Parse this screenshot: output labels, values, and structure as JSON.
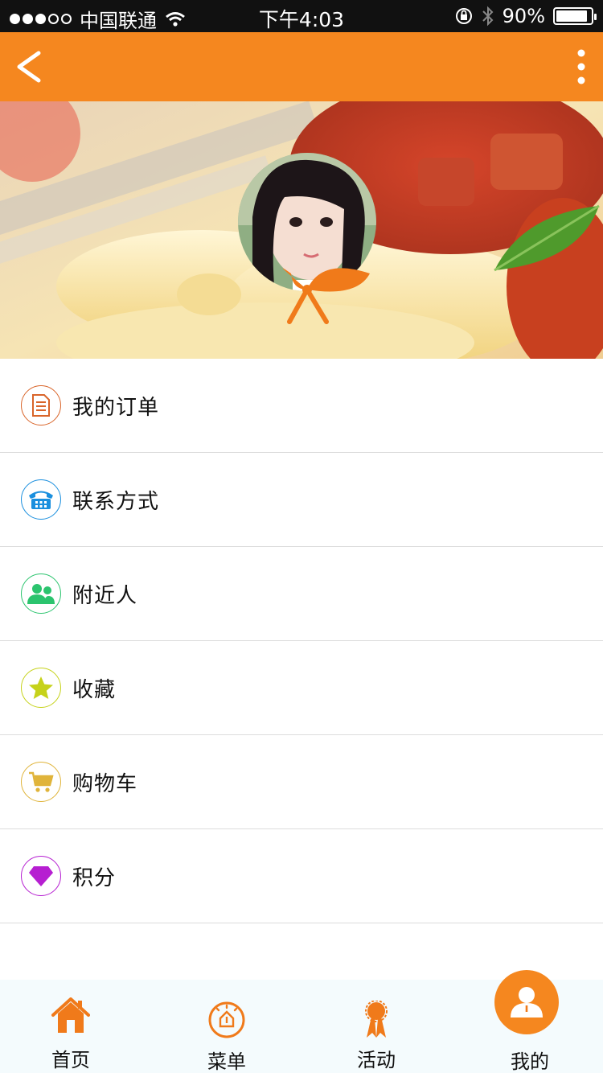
{
  "status_bar": {
    "carrier": "中国联通",
    "time": "下午4:03",
    "battery": "90%",
    "battery_level": 0.9,
    "signal_bars": 3
  },
  "nav": {
    "back_icon": "chevron-left-icon",
    "more_icon": "vertical-ellipsis-icon",
    "bg_color": "#f5871f"
  },
  "menu": {
    "items": [
      {
        "label": "我的订单",
        "icon": "document-icon",
        "color": "#d9652a"
      },
      {
        "label": "联系方式",
        "icon": "telephone-icon",
        "color": "#1a8fde"
      },
      {
        "label": "附近人",
        "icon": "people-icon",
        "color": "#2bc46e"
      },
      {
        "label": "收藏",
        "icon": "star-icon",
        "color": "#c6d21a"
      },
      {
        "label": "购物车",
        "icon": "cart-icon",
        "color": "#e0b43a"
      },
      {
        "label": "积分",
        "icon": "diamond-icon",
        "color": "#b61fd1"
      }
    ]
  },
  "tabs": [
    {
      "label": "首页",
      "icon": "home-icon"
    },
    {
      "label": "菜单",
      "icon": "menu-dish-icon"
    },
    {
      "label": "活动",
      "icon": "ribbon-icon"
    },
    {
      "label": "我的",
      "icon": "user-icon",
      "active": true
    }
  ],
  "colors": {
    "accent": "#f5871f",
    "tabbar_bg": "#f4fbfd"
  }
}
